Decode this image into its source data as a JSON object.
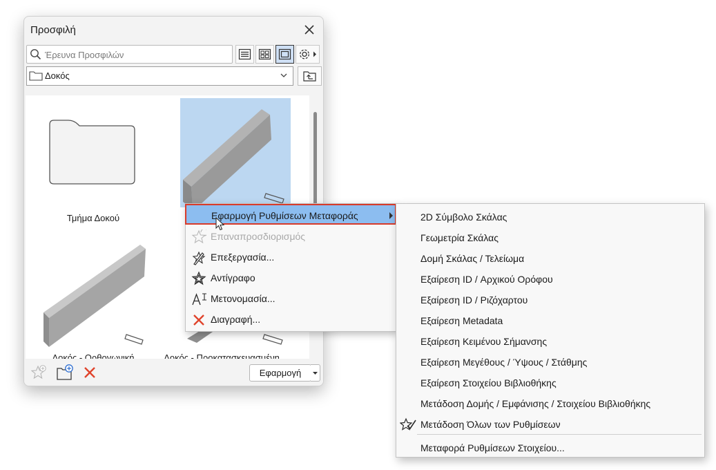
{
  "palette": {
    "title": "Προσφιλή",
    "search_placeholder": "Έρευνα Προσφιλών",
    "folder_path": "Δοκός",
    "items": [
      {
        "label": "Τμήμα Δοκού"
      },
      {
        "label": ""
      },
      {
        "label": "Δοκός - Ορθογωνική"
      },
      {
        "label": "Δοκός - Προκατασκευασμένη"
      }
    ],
    "apply_label": "Εφαρμογή"
  },
  "context_menu": {
    "items": [
      {
        "label": "Εφαρμογή Ρυθμίσεων Μεταφοράς",
        "icon": "none",
        "state": "highlighted",
        "has_submenu": true
      },
      {
        "label": "Επαναπροσδιορισμός",
        "icon": "star-refresh-icon",
        "state": "disabled"
      },
      {
        "label": "Επεξεργασία...",
        "icon": "edit-star-icon",
        "state": "enabled"
      },
      {
        "label": "Αντίγραφο",
        "icon": "star-copy-icon",
        "state": "enabled"
      },
      {
        "label": "Μετονομασία...",
        "icon": "rename-icon",
        "state": "enabled"
      },
      {
        "label": "Διαγραφή...",
        "icon": "delete-icon",
        "state": "enabled"
      }
    ]
  },
  "submenu": {
    "items": [
      {
        "label": "2D Σύμβολο Σκάλας"
      },
      {
        "label": "Γεωμετρία Σκάλας"
      },
      {
        "label": "Δομή Σκάλας / Τελείωμα"
      },
      {
        "label": "Εξαίρεση ID / Αρχικού Ορόφου"
      },
      {
        "label": "Εξαίρεση ID / Ριζόχαρτου"
      },
      {
        "label": "Εξαίρεση Metadata"
      },
      {
        "label": "Εξαίρεση Κειμένου Σήμανσης"
      },
      {
        "label": "Εξαίρεση Μεγέθους / Ύψους / Στάθμης"
      },
      {
        "label": "Εξαίρεση Στοιχείου Βιβλιοθήκης"
      },
      {
        "label": "Μετάδοση Δομής / Εμφάνισης / Στοιχείου Βιβλιοθήκης"
      },
      {
        "label": "Μετάδοση Όλων των Ρυθμίσεων",
        "icon": "star-check-icon"
      },
      {
        "label": "Μεταφορά Ρυθμίσεων Στοιχείου..."
      }
    ]
  },
  "colors": {
    "highlight": "#8cbdf0",
    "highlight_border": "#d83a2a",
    "selected_thumb": "#bcd7f1",
    "delete_red": "#e0442c"
  }
}
